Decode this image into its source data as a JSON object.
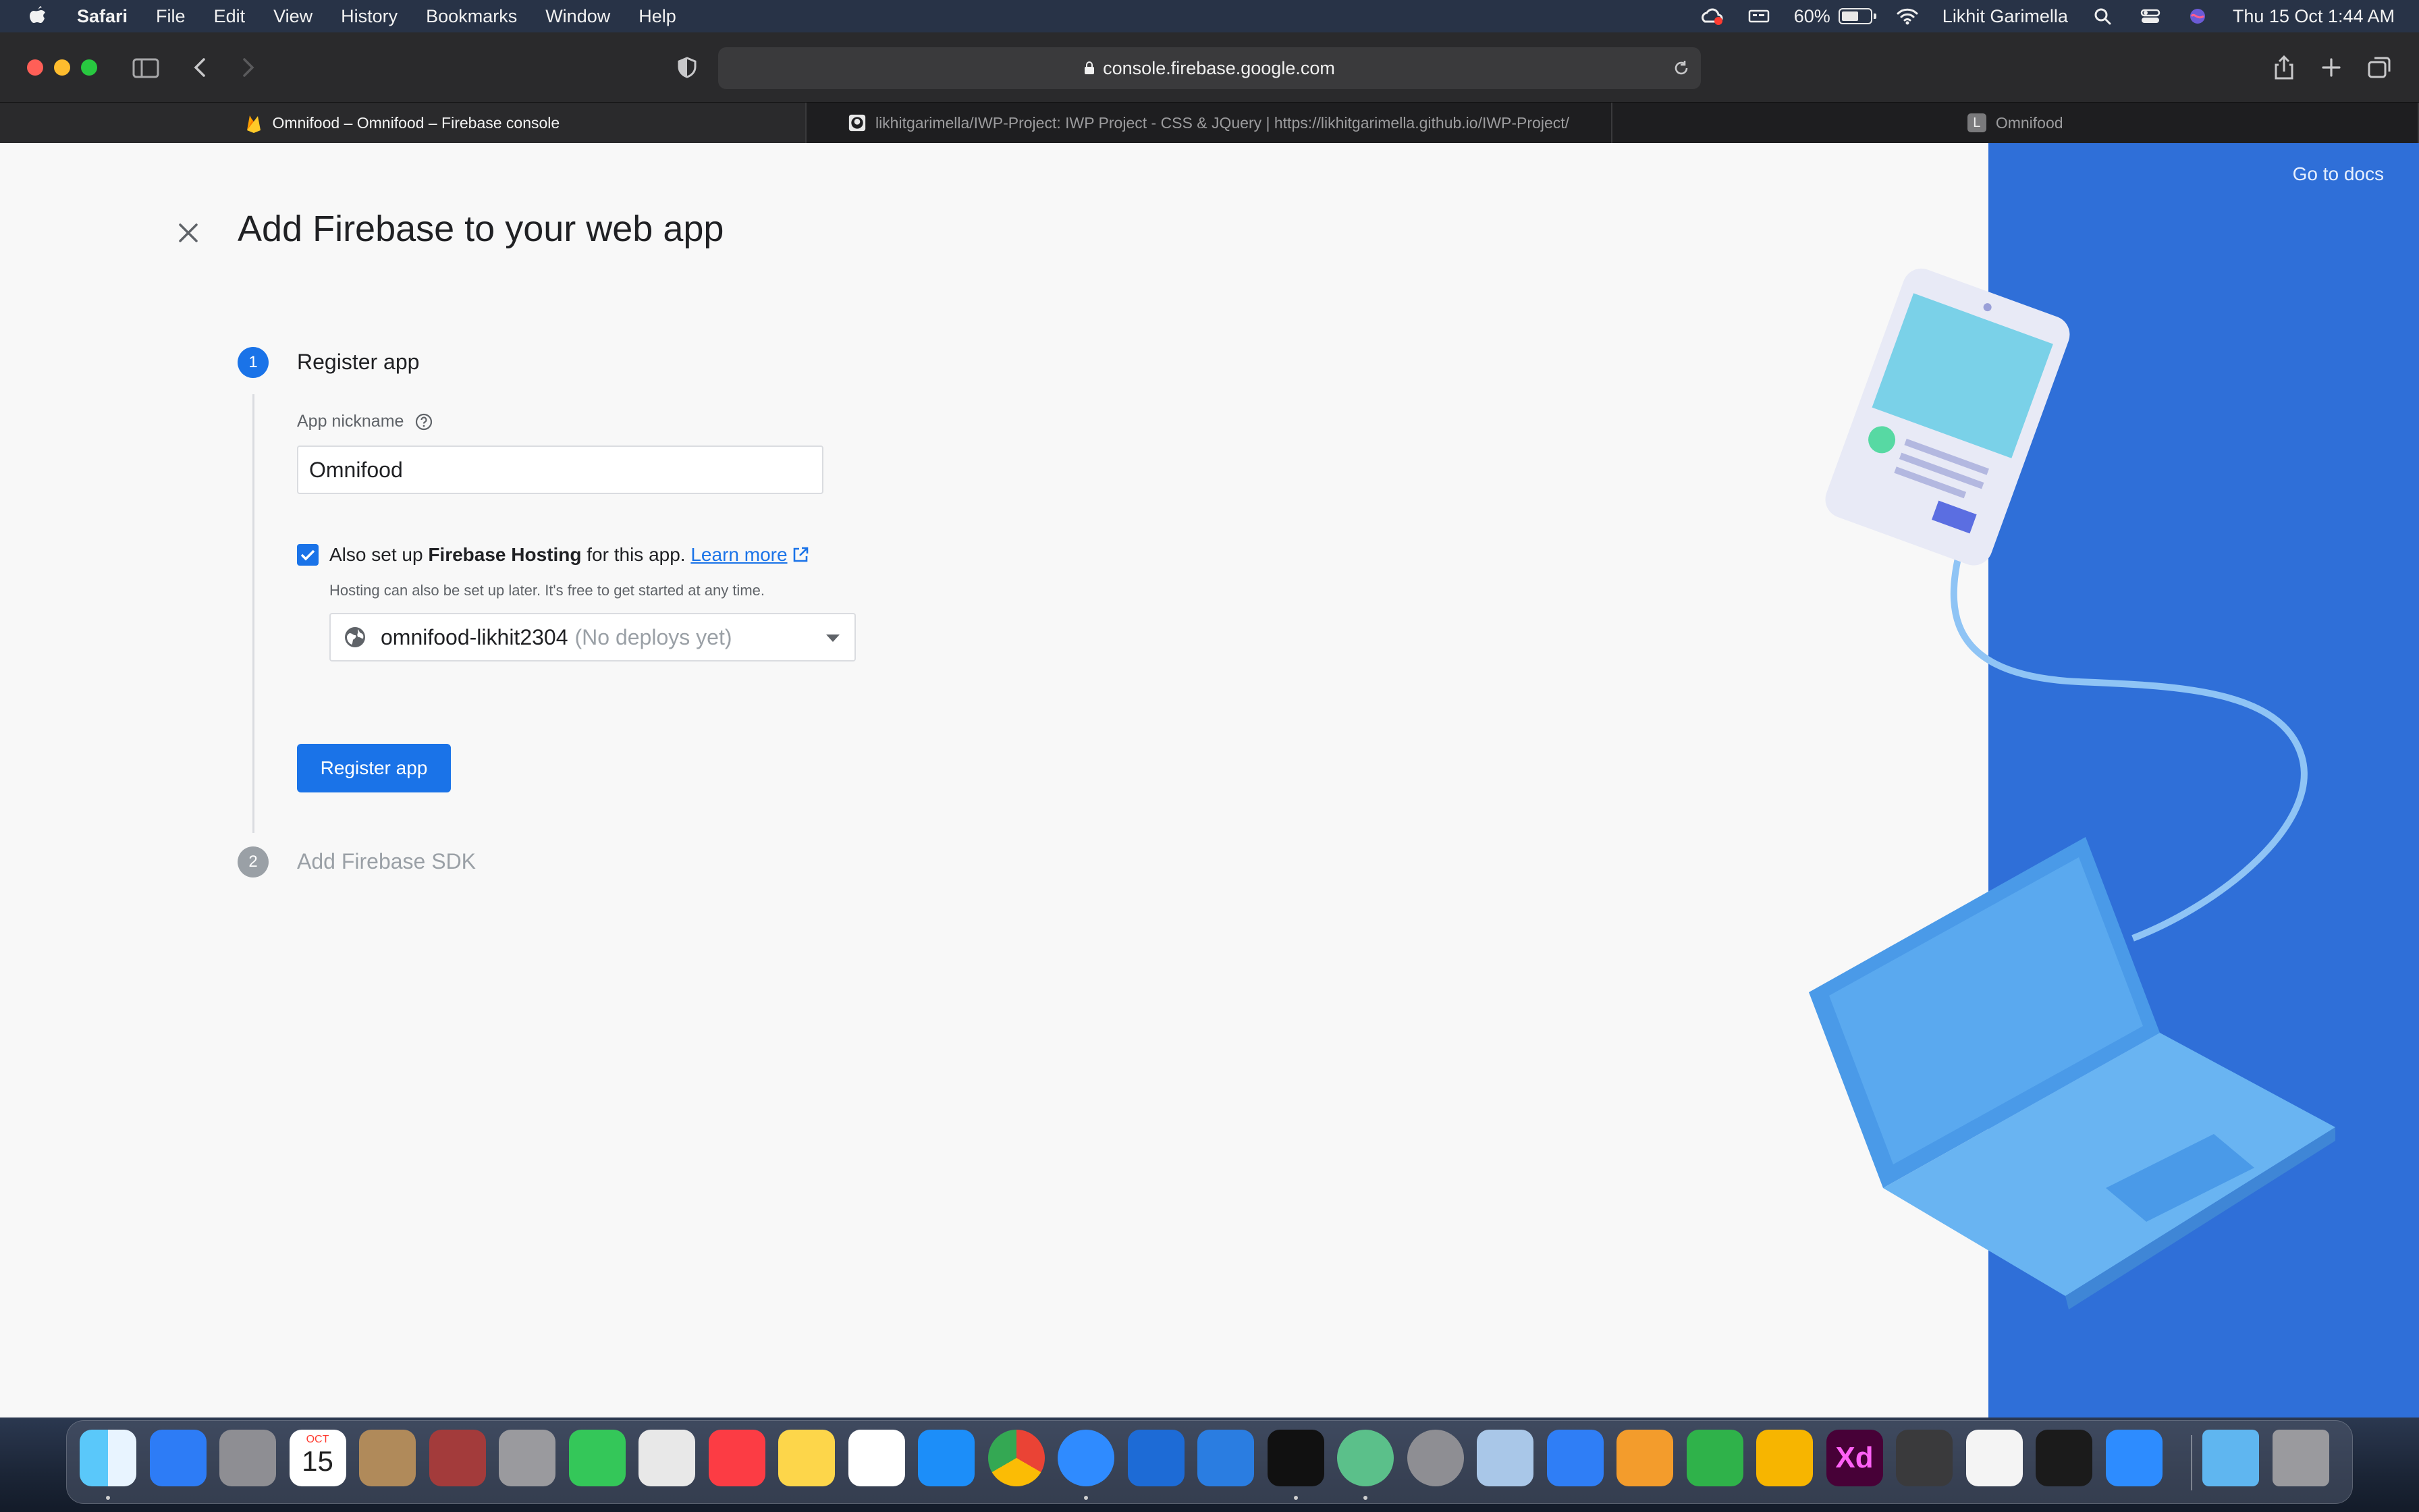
{
  "menubar": {
    "app_name": "Safari",
    "menus": [
      "File",
      "Edit",
      "View",
      "History",
      "Bookmarks",
      "Window",
      "Help"
    ],
    "battery_percent": "60%",
    "battery_level": 0.6,
    "user_name": "Likhit Garimella",
    "datetime": "Thu 15 Oct  1:44 AM"
  },
  "browser": {
    "url": "console.firebase.google.com",
    "tabs": [
      {
        "title": "Omnifood – Omnifood – Firebase console",
        "active": true
      },
      {
        "title": "likhitgarimella/IWP-Project: IWP Project - CSS & JQuery | https://likhitgarimella.github.io/IWP-Project/",
        "active": false
      },
      {
        "title": "Omnifood",
        "active": false,
        "favicon_letter": "L"
      }
    ]
  },
  "page": {
    "title": "Add Firebase to your web app",
    "go_to_docs": "Go to docs",
    "step1": {
      "number": "1",
      "label": "Register app",
      "nickname_label": "App nickname",
      "nickname_value": "Omnifood",
      "hosting_checked": true,
      "hosting_prefix": "Also set up ",
      "hosting_bold": "Firebase Hosting",
      "hosting_suffix": " for this app. ",
      "learn_more": "Learn more",
      "hosting_hint": "Hosting can also be set up later. It's free to get started at any time.",
      "site_name": "omnifood-likhit2304",
      "site_status": "(No deploys yet)",
      "register_button": "Register app"
    },
    "step2": {
      "number": "2",
      "label": "Add Firebase SDK"
    }
  },
  "colors": {
    "accent": "#1a73e8",
    "panel_blue": "#2f6fd8",
    "step_inactive": "#9aa0a6"
  },
  "dock": {
    "apps": [
      "finder",
      "bluetooth",
      "launchpad",
      "calendar",
      "contacts",
      "dictionary",
      "font-book",
      "facetime",
      "maps",
      "music",
      "notes",
      "photos",
      "app-store",
      "chrome",
      "safari",
      "xcode",
      "xcode-beta",
      "terminal",
      "atom",
      "system-preferences",
      "preview",
      "keynote",
      "pages",
      "numbers",
      "sketch",
      "adobe-xd",
      "quicktime",
      "textedit",
      "activity-monitor",
      "zoom",
      "downloads",
      "trash"
    ],
    "calendar_month": "OCT",
    "calendar_day": "15",
    "xd_label": "Xd"
  }
}
